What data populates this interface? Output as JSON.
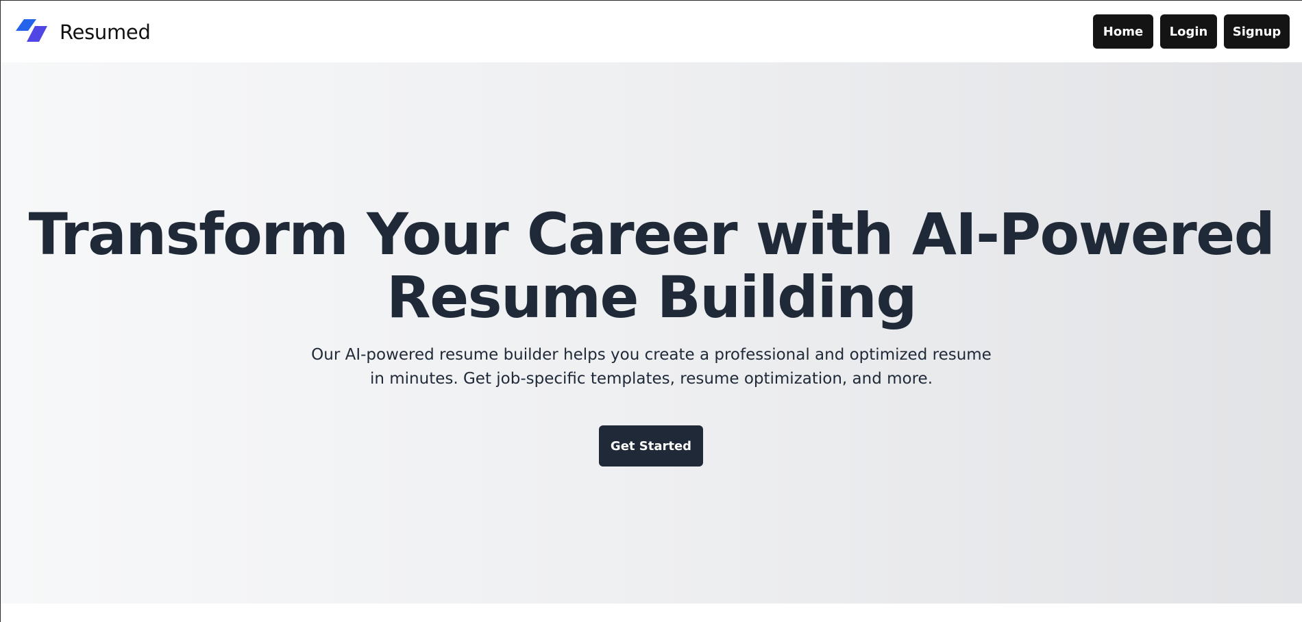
{
  "brand": {
    "name": "Resumed",
    "logo_icon": "parallelogram-logo-icon",
    "logo_colors": [
      "#2563eb",
      "#4f46e5"
    ]
  },
  "nav": {
    "items": [
      {
        "label": "Home"
      },
      {
        "label": "Login"
      },
      {
        "label": "Signup"
      }
    ]
  },
  "hero": {
    "title_line1": "Transform Your Career with AI-Powered",
    "title_line2": "Resume Building",
    "subtitle_line1": "Our AI-powered resume builder helps you create a professional and optimized resume",
    "subtitle_line2": "in minutes. Get job-specific templates, resume optimization, and more.",
    "cta_label": "Get Started"
  },
  "colors": {
    "nav_button_bg": "#141414",
    "cta_bg": "#1f2937",
    "heading": "#1f2937"
  }
}
